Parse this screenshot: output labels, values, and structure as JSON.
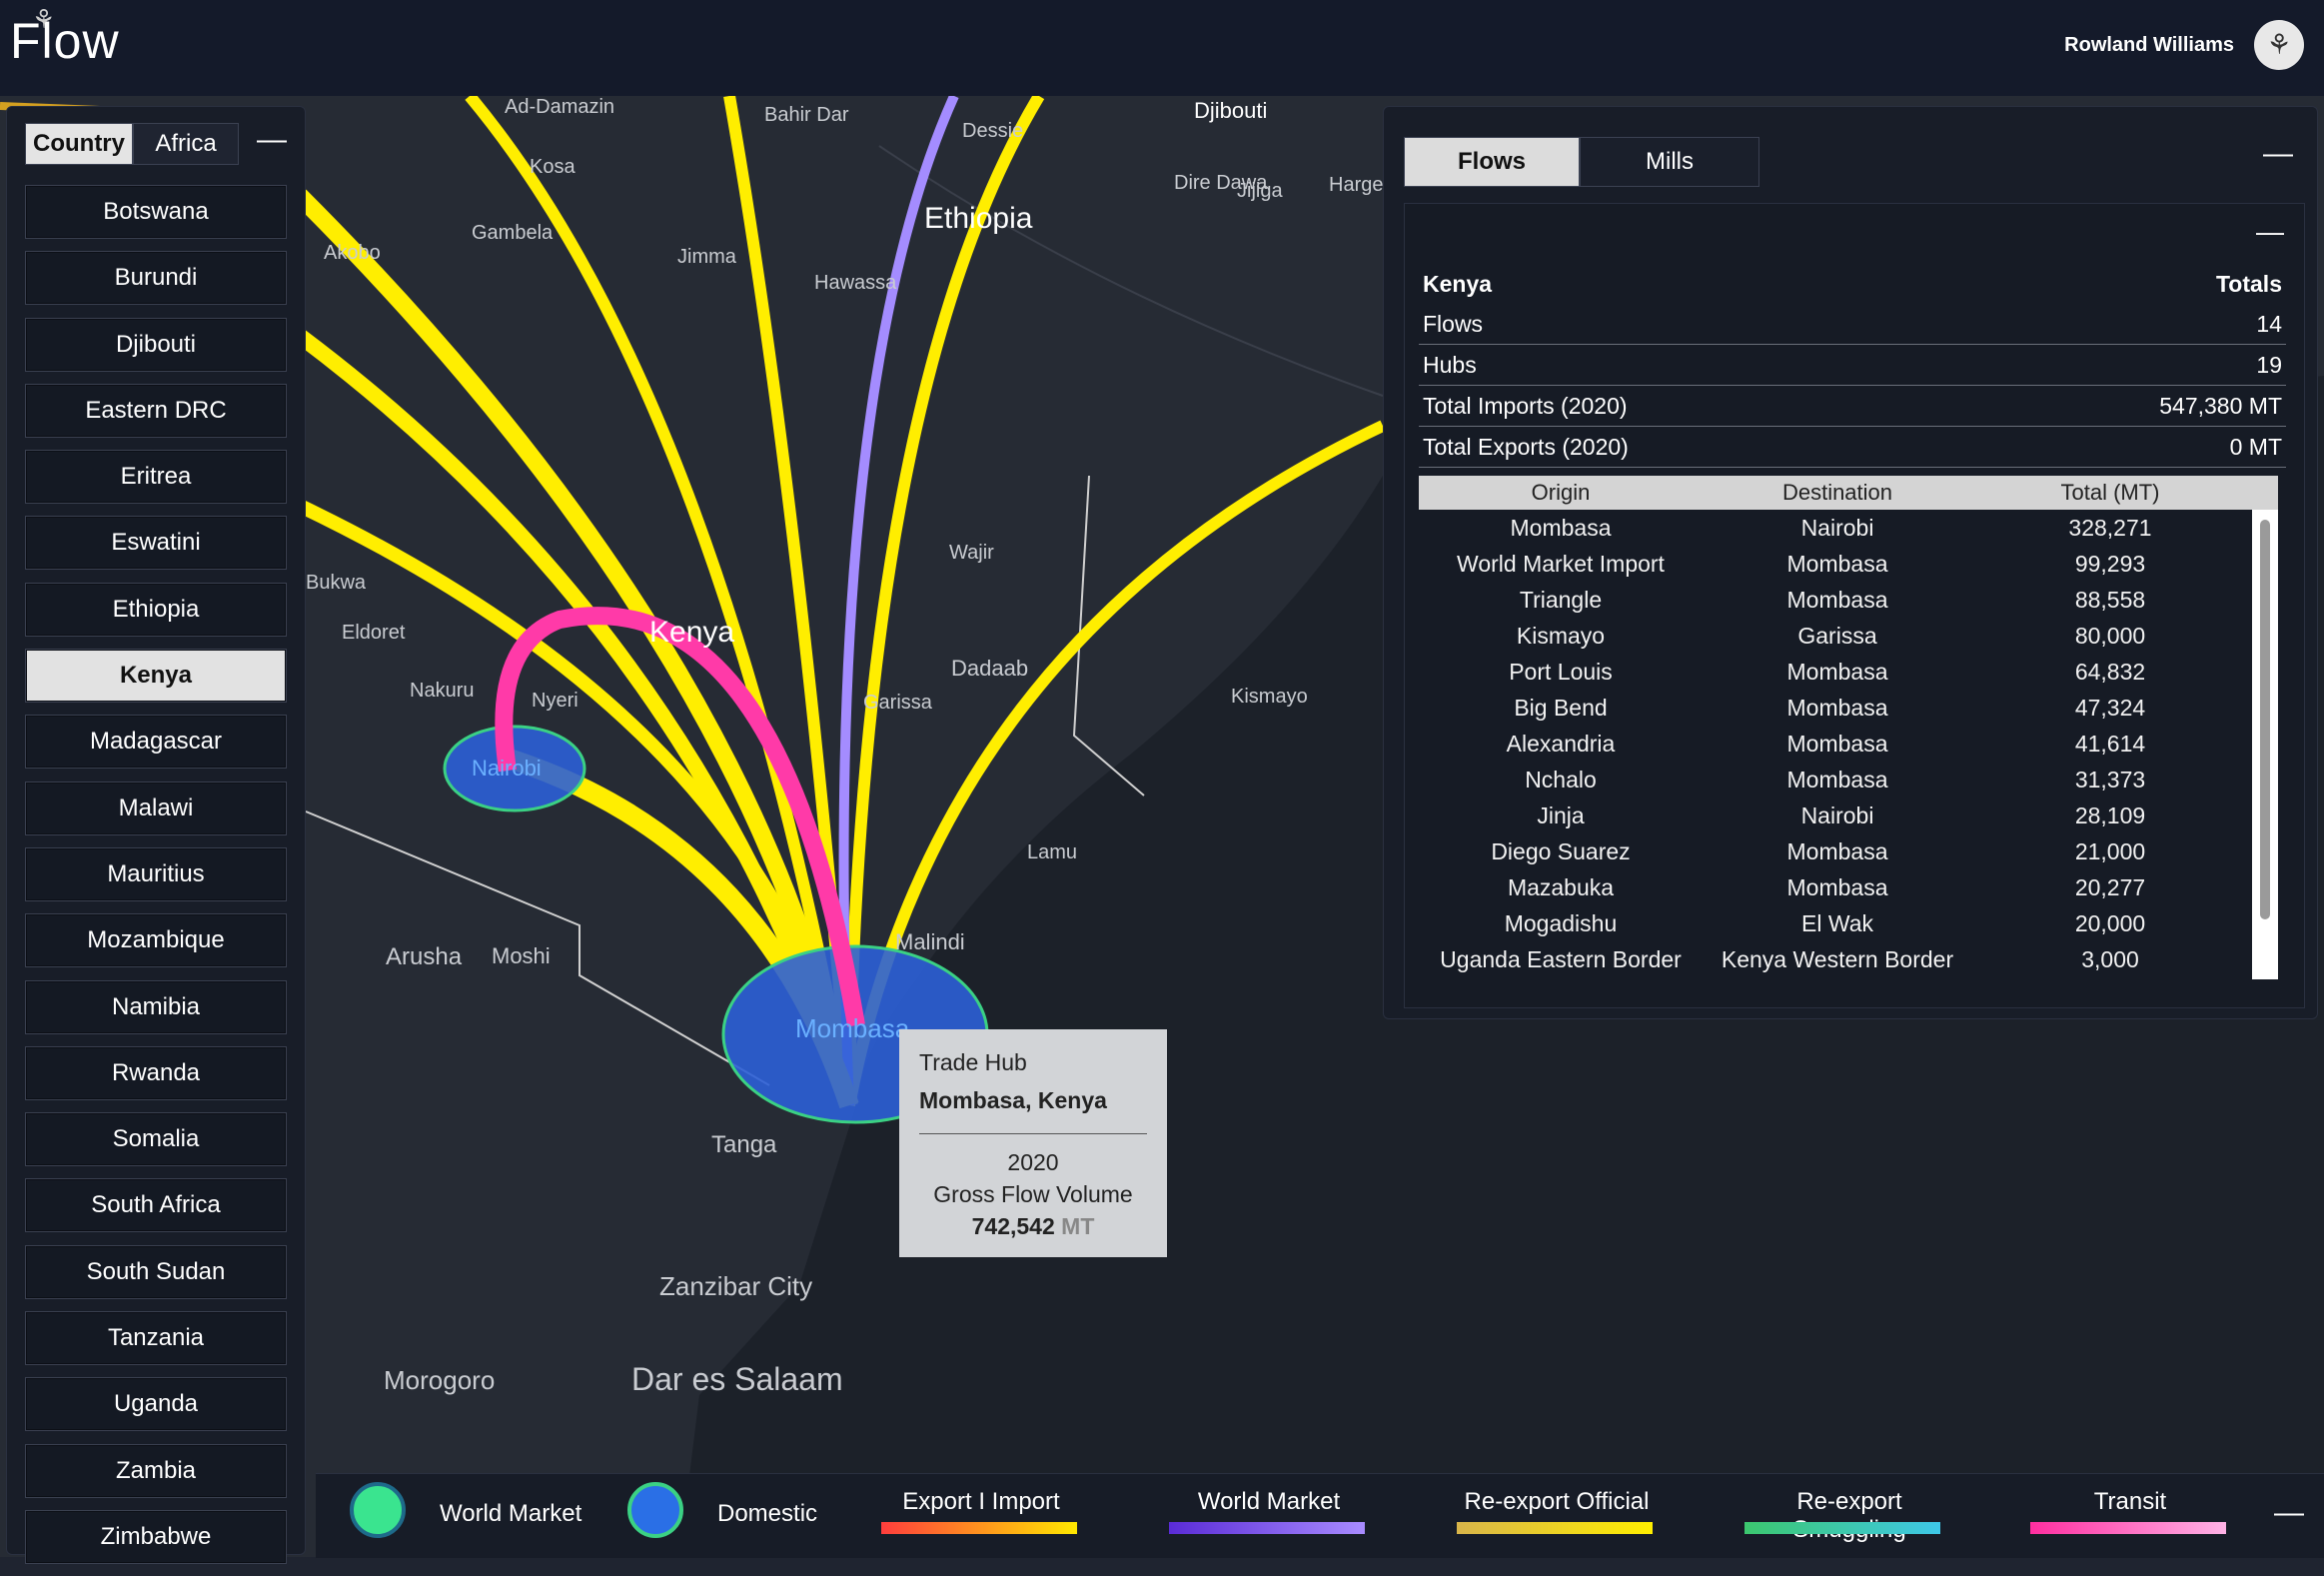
{
  "app": {
    "name": "Flow",
    "user_name": "Rowland Williams"
  },
  "sidebar": {
    "toggle": {
      "country_label": "Country",
      "region_label": "Africa",
      "active": "Country"
    },
    "countries": [
      "Botswana",
      "Burundi",
      "Djibouti",
      "Eastern DRC",
      "Eritrea",
      "Eswatini",
      "Ethiopia",
      "Kenya",
      "Madagascar",
      "Malawi",
      "Mauritius",
      "Mozambique",
      "Namibia",
      "Rwanda",
      "Somalia",
      "South Africa",
      "South Sudan",
      "Tanzania",
      "Uganda",
      "Zambia",
      "Zimbabwe"
    ],
    "selected": "Kenya"
  },
  "panel": {
    "tabs": [
      "Flows",
      "Mills"
    ],
    "active_tab": "Flows",
    "summary": {
      "title": "Kenya",
      "totals_label": "Totals",
      "rows": [
        {
          "label": "Flows",
          "value": "14"
        },
        {
          "label": "Hubs",
          "value": "19"
        },
        {
          "label": "Total Imports (2020)",
          "value": "547,380 MT"
        },
        {
          "label": "Total Exports (2020)",
          "value": "0 MT"
        }
      ]
    },
    "table": {
      "headers": [
        "Origin",
        "Destination",
        "Total (MT)"
      ],
      "rows": [
        [
          "Mombasa",
          "Nairobi",
          "328,271"
        ],
        [
          "World Market Import",
          "Mombasa",
          "99,293"
        ],
        [
          "Triangle",
          "Mombasa",
          "88,558"
        ],
        [
          "Kismayo",
          "Garissa",
          "80,000"
        ],
        [
          "Port Louis",
          "Mombasa",
          "64,832"
        ],
        [
          "Big Bend",
          "Mombasa",
          "47,324"
        ],
        [
          "Alexandria",
          "Mombasa",
          "41,614"
        ],
        [
          "Nchalo",
          "Mombasa",
          "31,373"
        ],
        [
          "Jinja",
          "Nairobi",
          "28,109"
        ],
        [
          "Diego Suarez",
          "Mombasa",
          "21,000"
        ],
        [
          "Mazabuka",
          "Mombasa",
          "20,277"
        ],
        [
          "Mogadishu",
          "El Wak",
          "20,000"
        ],
        [
          "Uganda Eastern Border",
          "Kenya Western Border",
          "3,000"
        ]
      ]
    }
  },
  "tooltip": {
    "type": "Trade Hub",
    "location": "Mombasa, Kenya",
    "year": "2020",
    "metric": "Gross Flow Volume",
    "value": "742,542",
    "unit": "MT"
  },
  "map_labels": [
    "Ad-Damazin",
    "Bahir Dar",
    "Djibouti",
    "Dessie",
    "Dire Dawa",
    "Jijiga",
    "Harge",
    "Ethiopia",
    "Kosa",
    "Gambela",
    "Akobo",
    "Jimma",
    "Hawassa",
    "Bukwa",
    "Eldoret",
    "Nakuru",
    "Nyeri",
    "Kenya",
    "Wajir",
    "Dadaab",
    "Garissa",
    "Kismayo",
    "Nairobi",
    "Lamu",
    "Malindi",
    "Arusha",
    "Moshi",
    "Mombasa",
    "Tanga",
    "Zanzibar City",
    "Morogoro",
    "Dar es Salaam"
  ],
  "legend": {
    "hubs": [
      {
        "label": "World Market",
        "color": "#3ae48f"
      },
      {
        "label": "Domestic",
        "color": "#2a6fe6"
      }
    ],
    "flows": [
      {
        "label": "Export I Import",
        "from": "#ff3d3d",
        "to": "#ffe800"
      },
      {
        "label": "World Market",
        "from": "#5a2bd6",
        "to": "#a98cff"
      },
      {
        "label": "Re-export Official",
        "from": "#d9b54a",
        "to": "#ffee00"
      },
      {
        "label": "Re-export Smuggling",
        "from": "#3cc76e",
        "to": "#3ec8e8"
      },
      {
        "label": "Transit",
        "from": "#ff2ea0",
        "to": "#ffb3e6"
      }
    ]
  },
  "colors": {
    "flow_yellow": "#ffee00",
    "flow_purple": "#a48cff",
    "flow_pink": "#ff3aa8",
    "hub_fill": "#2c5fd6",
    "hub_stroke": "#3bd184"
  }
}
